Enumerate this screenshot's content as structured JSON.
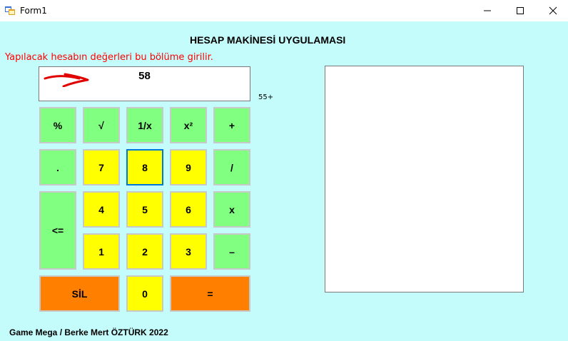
{
  "window": {
    "title": "Form1",
    "controls": {
      "minimize": "—",
      "maximize": "☐",
      "close": "✕"
    }
  },
  "heading": "HESAP MAKİNESİ UYGULAMASI",
  "hint": "Yapılacak hesabın değerleri bu bölüme girilir.",
  "display": {
    "value": "58",
    "pending": "55+"
  },
  "buttons": {
    "percent": "%",
    "sqrt": "√",
    "reciprocal": "1/x",
    "square": "x²",
    "plus": "+",
    "dot": ".",
    "seven": "7",
    "eight": "8",
    "nine": "9",
    "divide": "/",
    "four": "4",
    "five": "5",
    "six": "6",
    "multiply": "x",
    "backspace": "<=",
    "one": "1",
    "two": "2",
    "three": "3",
    "minus": "–",
    "clear": "SİL",
    "zero": "0",
    "equals": "="
  },
  "footer": "Game Mega / Berke Mert ÖZTÜRK 2022",
  "colors": {
    "background": "#c4fcfc",
    "function_key": "#80ff80",
    "digit_key": "#ffff00",
    "action_key": "#ff8000",
    "hint": "#ff0000"
  }
}
